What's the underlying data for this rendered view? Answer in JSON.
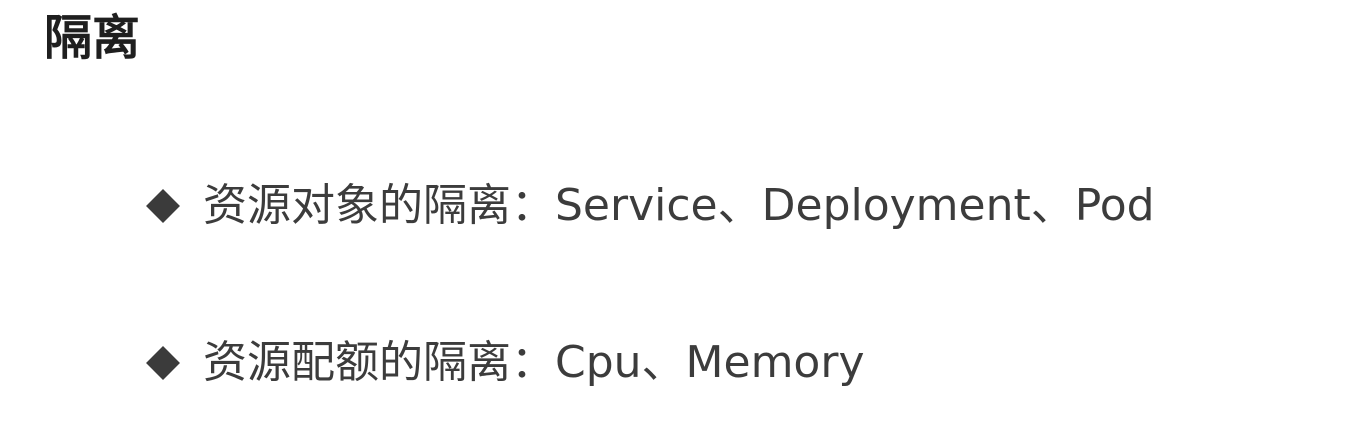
{
  "slide": {
    "title": "隔离",
    "bullets": [
      {
        "text": "资源对象的隔离：Service、Deployment、Pod"
      },
      {
        "text": "资源配额的隔离：Cpu、Memory"
      }
    ]
  },
  "colors": {
    "title": "#1f1f1f",
    "body_text": "#3c3c3c",
    "bullet_marker": "#3b3b3b",
    "background": "#ffffff"
  },
  "icons": {
    "bullet_marker": "diamond-icon"
  }
}
